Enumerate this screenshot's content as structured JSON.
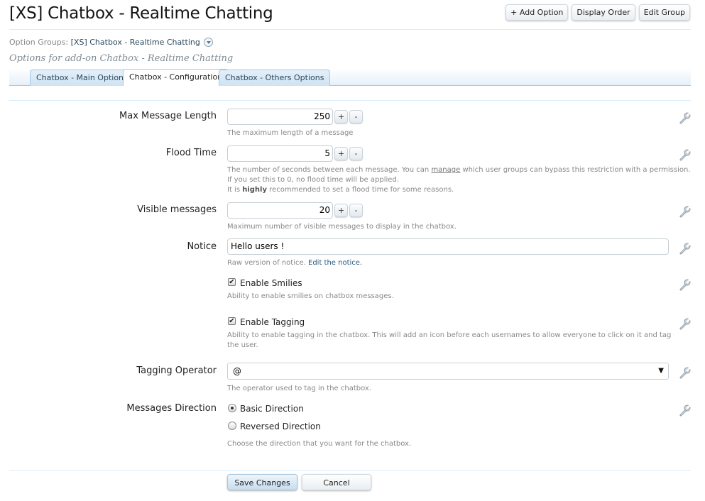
{
  "header": {
    "title": "[XS] Chatbox - Realtime Chatting",
    "buttons": {
      "add_option": "+ Add Option",
      "display_order": "Display Order",
      "edit_group": "Edit Group"
    }
  },
  "breadcrumb": {
    "prefix": "Option Groups:",
    "current": "[XS] Chatbox - Realtime Chatting"
  },
  "subtitle": "Options for add-on Chatbox - Realtime Chatting",
  "tabs": [
    {
      "label": "Chatbox - Main Options",
      "active": false
    },
    {
      "label": "Chatbox - Configuration",
      "active": true
    },
    {
      "label": "Chatbox - Others Options",
      "active": false
    }
  ],
  "options": {
    "max_length": {
      "label": "Max Message Length",
      "value": "250",
      "hint": "The maximum length of a message"
    },
    "flood_time": {
      "label": "Flood Time",
      "value": "5",
      "hint_line1_pre": "The number of seconds between each message. You can ",
      "hint_line1_link": "manage",
      "hint_line1_post": " which user groups can bypass this restriction with a permission.",
      "hint_line2": "If you set this to 0, no flood time will be applied.",
      "hint_line3_pre": "It is ",
      "hint_line3_bold": "highly",
      "hint_line3_post": " recommended to set a flood time for some reasons."
    },
    "visible_messages": {
      "label": "Visible messages",
      "value": "20",
      "hint": "Maximum number of visible messages to display in the chatbox."
    },
    "notice": {
      "label": "Notice",
      "value": "Hello users !",
      "hint_pre": "Raw version of notice. ",
      "hint_link": "Edit the notice."
    },
    "enable_smilies": {
      "label": "Enable Smilies",
      "checked": true,
      "hint": "Ability to enable smilies on chatbox messages."
    },
    "enable_tagging": {
      "label": "Enable Tagging",
      "checked": true,
      "hint_line1": "Ability to enable tagging in the chatbox. This will add an icon before each usernames to allow everyone to click on it and tag",
      "hint_line2": "the user."
    },
    "tagging_operator": {
      "label": "Tagging Operator",
      "value": "@",
      "hint": "The operator used to tag in the chatbox."
    },
    "messages_direction": {
      "label": "Messages Direction",
      "choices": [
        {
          "label": "Basic Direction",
          "selected": true
        },
        {
          "label": "Reversed Direction",
          "selected": false
        }
      ],
      "hint": "Choose the direction that you want for the chatbox."
    }
  },
  "stepper": {
    "plus": "+",
    "minus": "-"
  },
  "check_mark": "✔",
  "select_arrow": "▼",
  "footer": {
    "save": "Save Changes",
    "cancel": "Cancel"
  }
}
